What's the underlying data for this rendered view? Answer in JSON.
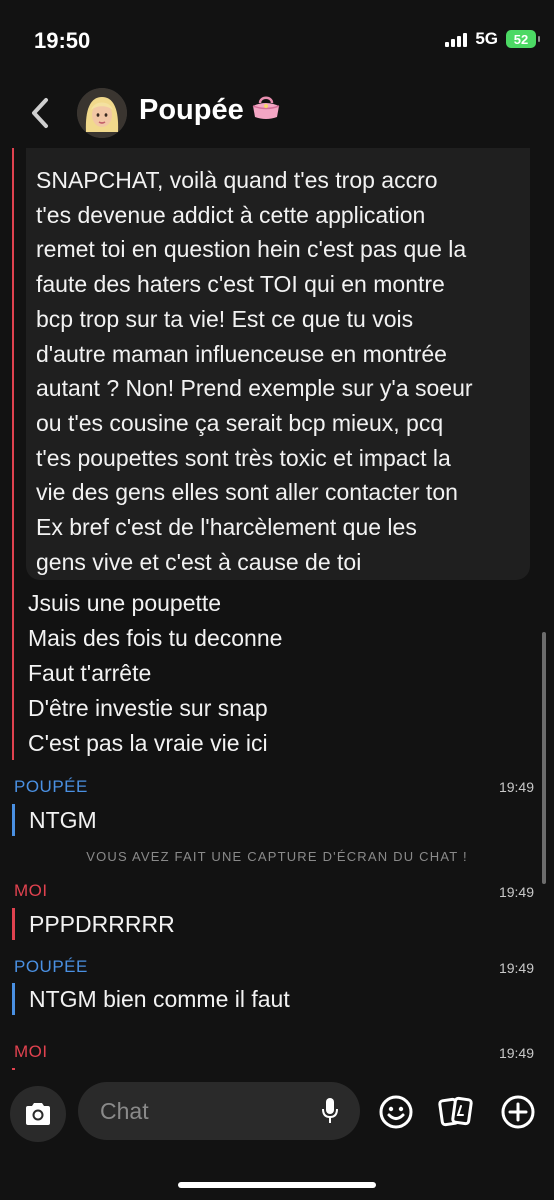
{
  "status": {
    "time": "19:50",
    "network": "5G",
    "battery": "52"
  },
  "header": {
    "name": "Poupée"
  },
  "quoted_message": {
    "lines": [
      "SNAPCHAT, voilà quand t'es trop accro",
      "t'es devenue addict à cette application",
      "remet toi en question hein c'est pas que la",
      "faute des haters c'est TOI qui en montre",
      "bcp trop sur ta vie! Est ce que tu vois",
      "d'autre maman influenceuse en montrée",
      "autant ? Non! Prend exemple sur y'a soeur",
      "ou t'es cousine ça serait bcp mieux, pcq",
      "t'es poupettes sont très toxic et impact la",
      "vie des gens elles sont aller contacter ton",
      "Ex bref c'est de l'harcèlement que les",
      "gens vive et c'est à cause de toi"
    ]
  },
  "reply_lines": [
    "Jsuis une poupette",
    "Mais des fois tu deconne",
    "Faut t'arrête",
    "D'être investie sur snap",
    "C'est pas la vraie vie ici"
  ],
  "messages": [
    {
      "sender": "POUPÉE",
      "time": "19:49",
      "text": "NTGM"
    },
    {
      "notice": "VOUS AVEZ FAIT UNE CAPTURE D'ÉCRAN DU CHAT !"
    },
    {
      "sender": "MOI",
      "time": "19:49",
      "text": "PPPDRRRRR"
    },
    {
      "sender": "POUPÉE",
      "time": "19:49",
      "text": "NTGM bien comme il faut"
    },
    {
      "sender": "MOI",
      "time": "19:49",
      "text": ""
    }
  ],
  "composer": {
    "placeholder": "Chat"
  },
  "colors": {
    "poupee": "#4a90e2",
    "moi": "#e0424f",
    "background": "#121212"
  },
  "icons": [
    "back-chevron-icon",
    "purse-emoji-icon",
    "camera-icon",
    "mic-icon",
    "smiley-icon",
    "cards-icon",
    "plus-icon"
  ]
}
